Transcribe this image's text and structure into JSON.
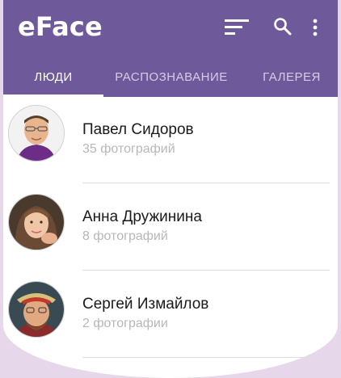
{
  "app": {
    "title": "eFace"
  },
  "toolbar": {
    "filter_icon": "sort-lines-icon",
    "search_icon": "search-icon",
    "more_icon": "more-vert-icon"
  },
  "tabs": [
    {
      "label": "ЛЮДИ",
      "active": true
    },
    {
      "label": "РАСПОЗНАВАНИЕ",
      "active": false
    },
    {
      "label": "ГАЛЕРЕЯ",
      "active": false
    }
  ],
  "people": [
    {
      "name": "Павел Сидоров",
      "count": "35 фотографий"
    },
    {
      "name": "Анна Дружинина",
      "count": "8 фотографий"
    },
    {
      "name": "Сергей Измайлов",
      "count": "2 фотографии"
    }
  ],
  "colors": {
    "appbar": "#6e5a9a",
    "accent": "#ffffff",
    "background": "#e6d7ea"
  }
}
